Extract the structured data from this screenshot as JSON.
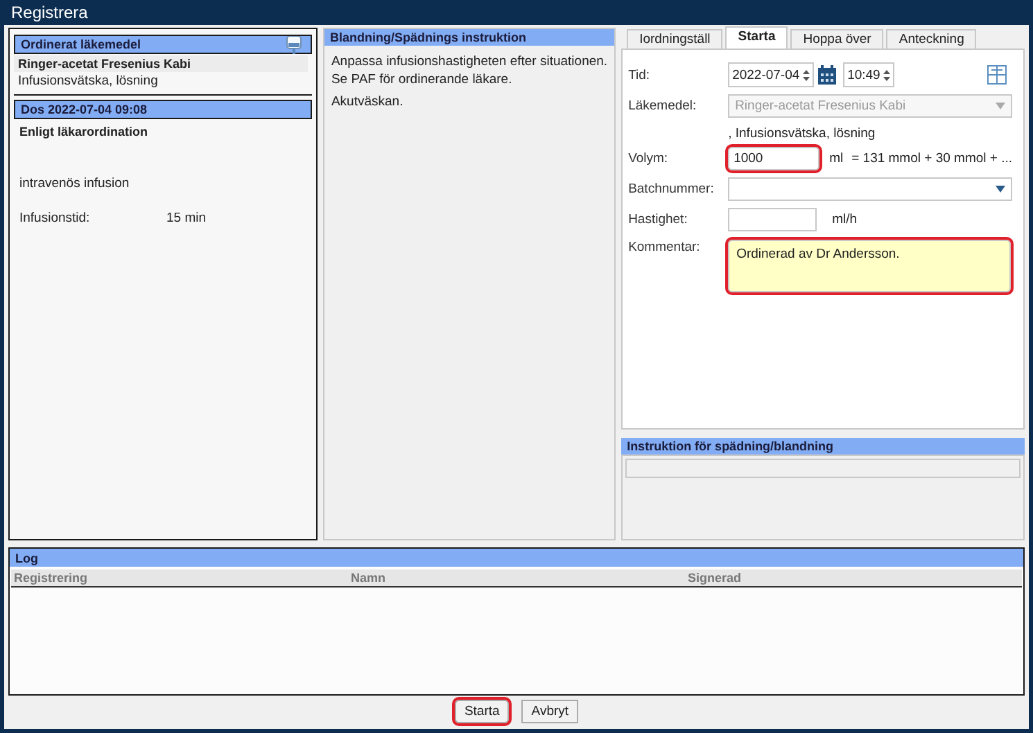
{
  "window": {
    "title": "Registrera"
  },
  "ordered": {
    "header": "Ordinerat läkemedel",
    "drug": "Ringer-acetat Fresenius Kabi",
    "form": "Infusionsvätska, lösning"
  },
  "dose": {
    "header": "Dos 2022-07-04 09:08",
    "instruction": "Enligt läkarordination",
    "route": "intravenös infusion",
    "time_label": "Infusionstid:",
    "time_value": "15 min"
  },
  "mixing": {
    "header": "Blandning/Spädnings instruktion",
    "lines": [
      "Anpassa infusionshastigheten efter situationen.",
      "Se PAF för ordinerande läkare.",
      "Akutväskan."
    ]
  },
  "tabs": [
    {
      "label": "Iordningställ",
      "selected": false
    },
    {
      "label": "Starta",
      "selected": true
    },
    {
      "label": "Hoppa över",
      "selected": false
    },
    {
      "label": "Anteckning",
      "selected": false
    }
  ],
  "form": {
    "time_label": "Tid:",
    "date": "2022-07-04",
    "time": "10:49",
    "drug_label": "Läkemedel:",
    "drug_value": "Ringer-acetat Fresenius Kabi",
    "drug_disabled": true,
    "drug_form": ", Infusionsvätska, lösning",
    "volume_label": "Volym:",
    "volume": "1000",
    "volume_highlighted": true,
    "volume_unit": "ml",
    "volume_note": "= 131 mmol + 30 mmol + ...",
    "batch_label": "Batchnummer:",
    "rate_label": "Hastighet:",
    "rate_unit": "ml/h",
    "comment_label": "Kommentar:",
    "comment": "Ordinerad av Dr Andersson.",
    "comment_highlighted": true
  },
  "dilution": {
    "header": "Instruktion för spädning/blandning"
  },
  "log": {
    "header": "Log",
    "columns": [
      "Registrering",
      "Namn",
      "Signerad"
    ]
  },
  "buttons": [
    {
      "label": "Starta",
      "highlighted": true
    },
    {
      "label": "Avbryt",
      "highlighted": false
    }
  ]
}
